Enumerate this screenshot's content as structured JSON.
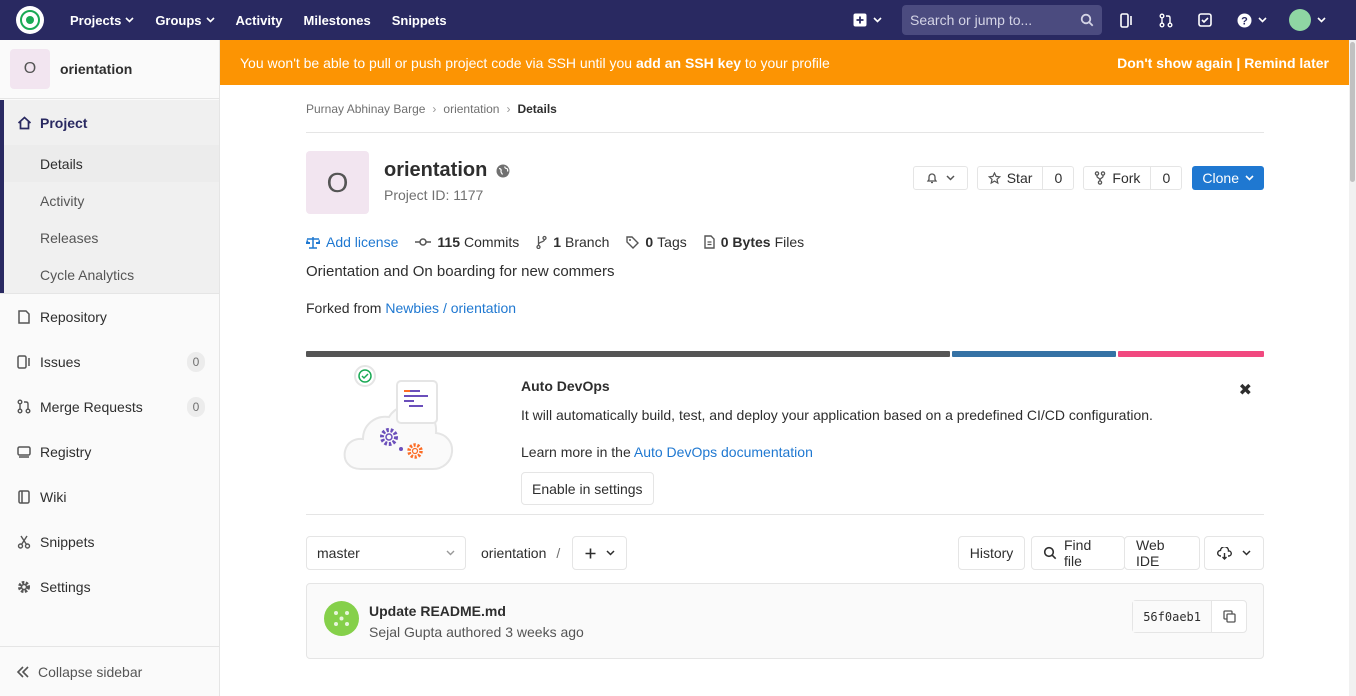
{
  "nav": {
    "links": [
      "Projects",
      "Groups",
      "Activity",
      "Milestones",
      "Snippets"
    ],
    "search_placeholder": "Search or jump to..."
  },
  "sidebar": {
    "project_initial": "O",
    "project_name": "orientation",
    "section_label": "Project",
    "sub_items": [
      "Details",
      "Activity",
      "Releases",
      "Cycle Analytics"
    ],
    "items": [
      {
        "label": "Repository"
      },
      {
        "label": "Issues",
        "count": "0"
      },
      {
        "label": "Merge Requests",
        "count": "0"
      },
      {
        "label": "Registry"
      },
      {
        "label": "Wiki"
      },
      {
        "label": "Snippets"
      },
      {
        "label": "Settings"
      }
    ],
    "collapse_label": "Collapse sidebar"
  },
  "banner": {
    "text_1": "You won't be able to pull or push project code via SSH until you ",
    "link": "add an SSH key",
    "text_2": " to your profile",
    "dont_show": "Don't show again",
    "separator": " | ",
    "remind": "Remind later"
  },
  "breadcrumb": [
    "Purnay Abhinay Barge",
    "orientation",
    "Details"
  ],
  "project": {
    "initial": "O",
    "name": "orientation",
    "id_text": "Project ID: 1177",
    "star_label": "Star",
    "star_count": "0",
    "fork_label": "Fork",
    "fork_count": "0",
    "clone_label": "Clone"
  },
  "stats": {
    "add_license": "Add license",
    "commits_count": "115",
    "commits_label": "Commits",
    "branch_count": "1",
    "branch_label": "Branch",
    "tags_count": "0",
    "tags_label": "Tags",
    "files_size": "0 Bytes",
    "files_label": "Files"
  },
  "description": "Orientation and On boarding for new commers",
  "forked": {
    "prefix": "Forked from ",
    "link": "Newbies / orientation"
  },
  "colors": {
    "nav_bg": "#292961",
    "banner_bg": "#fc9403",
    "link": "#1f78d1",
    "lang_1": "#555555",
    "lang_2": "#3572a5",
    "lang_3": "#f1497f"
  },
  "devops": {
    "title": "Auto DevOps",
    "text": "It will automatically build, test, and deploy your application based on a predefined CI/CD configuration.",
    "learn_prefix": "Learn more in the ",
    "learn_link": "Auto DevOps documentation",
    "button": "Enable in settings"
  },
  "repo": {
    "branch": "master",
    "path": "orientation",
    "path_sep": "/",
    "history": "History",
    "find_file": "Find file",
    "web_ide": "Web IDE"
  },
  "commit": {
    "title": "Update README.md",
    "author": "Sejal Gupta",
    "authored": "authored",
    "time": "3 weeks ago",
    "sha": "56f0aeb1"
  }
}
